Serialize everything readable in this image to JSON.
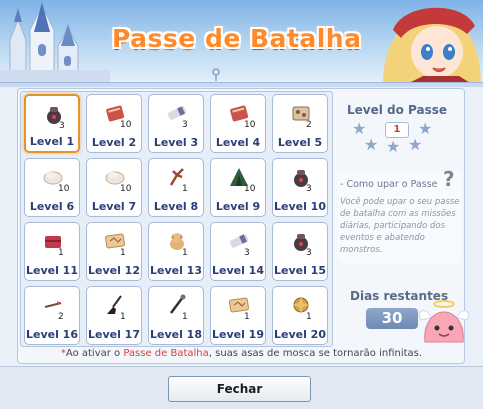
{
  "window": {
    "title": "Passe de Batalha"
  },
  "grid": {
    "items": [
      {
        "label": "Level 1",
        "qty": "3",
        "icon": "bag-icon",
        "selected": true
      },
      {
        "label": "Level 2",
        "qty": "10",
        "icon": "book-icon",
        "selected": false
      },
      {
        "label": "Level 3",
        "qty": "3",
        "icon": "ticket-icon",
        "selected": false
      },
      {
        "label": "Level 4",
        "qty": "10",
        "icon": "book-icon",
        "selected": false
      },
      {
        "label": "Level 5",
        "qty": "2",
        "icon": "box-icon",
        "selected": false
      },
      {
        "label": "Level 6",
        "qty": "10",
        "icon": "scroll-icon",
        "selected": false
      },
      {
        "label": "Level 7",
        "qty": "10",
        "icon": "scroll-icon",
        "selected": false
      },
      {
        "label": "Level 8",
        "qty": "1",
        "icon": "antler-icon",
        "selected": false
      },
      {
        "label": "Level 9",
        "qty": "10",
        "icon": "tent-icon",
        "selected": false
      },
      {
        "label": "Level 10",
        "qty": "3",
        "icon": "bag-icon",
        "selected": false
      },
      {
        "label": "Level 11",
        "qty": "1",
        "icon": "chest-icon",
        "selected": false
      },
      {
        "label": "Level 12",
        "qty": "1",
        "icon": "map-icon",
        "selected": false
      },
      {
        "label": "Level 13",
        "qty": "1",
        "icon": "dog-icon",
        "selected": false
      },
      {
        "label": "Level 14",
        "qty": "3",
        "icon": "ticket-icon",
        "selected": false
      },
      {
        "label": "Level 15",
        "qty": "3",
        "icon": "bag-icon",
        "selected": false
      },
      {
        "label": "Level 16",
        "qty": "2",
        "icon": "dart-icon",
        "selected": false
      },
      {
        "label": "Level 17",
        "qty": "1",
        "icon": "broom-icon",
        "selected": false
      },
      {
        "label": "Level 18",
        "qty": "1",
        "icon": "staff-icon",
        "selected": false
      },
      {
        "label": "Level 19",
        "qty": "1",
        "icon": "map-icon",
        "selected": false
      },
      {
        "label": "Level 20",
        "qty": "1",
        "icon": "emblem-icon",
        "selected": false
      }
    ]
  },
  "pass_level": {
    "title": "Level do Passe",
    "value": "1"
  },
  "howto": {
    "title": "- Como upar o Passe",
    "question_mark": "?",
    "text": "Você pode upar o seu passe de batalha com as missões diárias, participando dos eventos e abatendo monstros."
  },
  "days": {
    "title": "Dias restantes",
    "value": "30"
  },
  "note": {
    "asterisk": "*",
    "prefix": "Ao ativar o ",
    "highlight": "Passe de Batalha",
    "suffix": ", suas asas de mosca se tornarão infinitas."
  },
  "footer": {
    "close_label": "Fechar"
  },
  "colors": {
    "accent": "#e7912b",
    "level_text": "#2b3e78",
    "highlight": "#d8423f"
  }
}
